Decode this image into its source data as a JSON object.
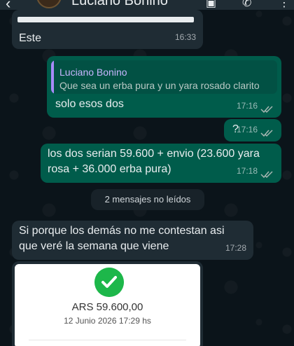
{
  "header": {
    "contact_name": "Luciano Bonino",
    "back_icon": "back-arrow-icon",
    "video_icon": "video-call-icon",
    "call_icon": "phone-icon",
    "menu_icon": "more-vert-icon"
  },
  "messages": [
    {
      "direction": "in",
      "text": "Este",
      "time": "16:33"
    },
    {
      "direction": "out",
      "quote": {
        "author": "Luciano Bonino",
        "text": "Que sea un erba pura y un yara rosado clarito"
      },
      "text": "solo esos dos",
      "time": "17:16",
      "status": "read"
    },
    {
      "direction": "out",
      "text": "?",
      "time": "17:16",
      "status": "read"
    },
    {
      "direction": "out",
      "text": "los dos serian 59.600 + envio (23.600 yara rosa + 36.000 erba pura)",
      "time": "17:18",
      "status": "read"
    },
    {
      "direction": "in",
      "text": "Si porque los demás no me contestan asi que veré la semana que viene",
      "time": "17:28"
    }
  ],
  "unread_banner": "2 mensajes no leídos",
  "receipt": {
    "amount": "ARS 59.600,00",
    "date": "12 Junio 2026 17:29 hs",
    "icon": "check-circle-icon"
  },
  "colors": {
    "background": "#0b141a",
    "incoming_bubble": "#1f2c34",
    "outgoing_bubble": "#005c4b",
    "read_ticks": "#53bdeb",
    "success_green": "#1db74a"
  }
}
